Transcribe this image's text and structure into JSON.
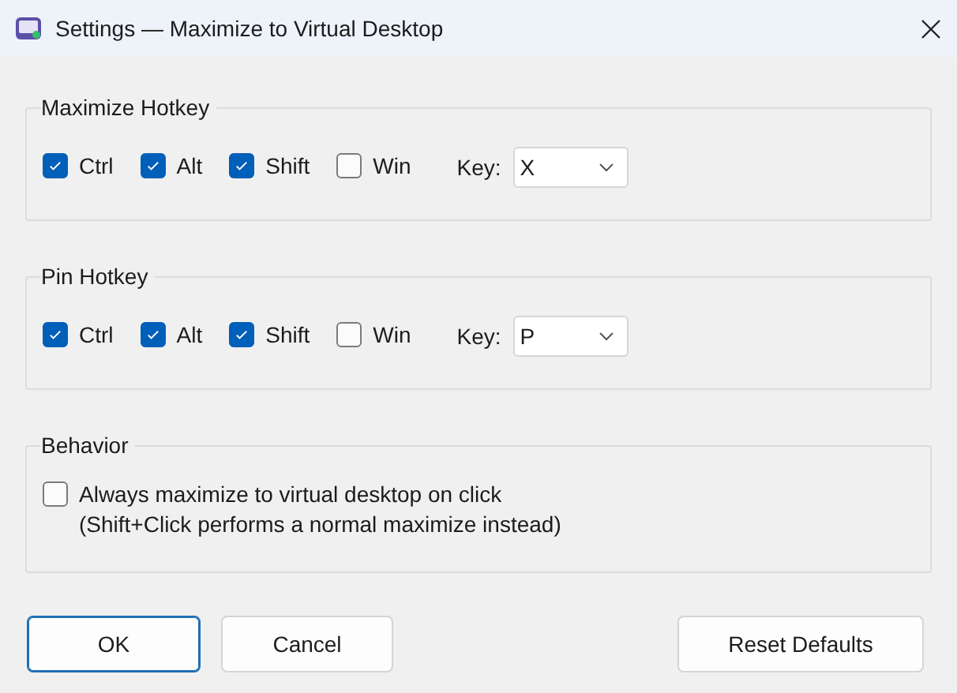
{
  "window": {
    "title": "Settings — Maximize to Virtual Desktop"
  },
  "groups": [
    {
      "title": "Maximize Hotkey",
      "modifiers": [
        {
          "label": "Ctrl",
          "checked": true
        },
        {
          "label": "Alt",
          "checked": true
        },
        {
          "label": "Shift",
          "checked": true
        },
        {
          "label": "Win",
          "checked": false
        }
      ],
      "key_label": "Key:",
      "key": "X"
    },
    {
      "title": "Pin Hotkey",
      "modifiers": [
        {
          "label": "Ctrl",
          "checked": true
        },
        {
          "label": "Alt",
          "checked": true
        },
        {
          "label": "Shift",
          "checked": true
        },
        {
          "label": "Win",
          "checked": false
        }
      ],
      "key_label": "Key:",
      "key": "P"
    }
  ],
  "behavior": {
    "title": "Behavior",
    "options": [
      {
        "lines": [
          "Always maximize to virtual desktop on click",
          "(Shift+Click performs a normal maximize instead)"
        ],
        "checked": false
      }
    ]
  },
  "buttons": [
    {
      "label": "OK",
      "default": true
    },
    {
      "label": "Cancel",
      "default": false
    }
  ],
  "reset_button": {
    "label": "Reset Defaults",
    "default": false
  }
}
